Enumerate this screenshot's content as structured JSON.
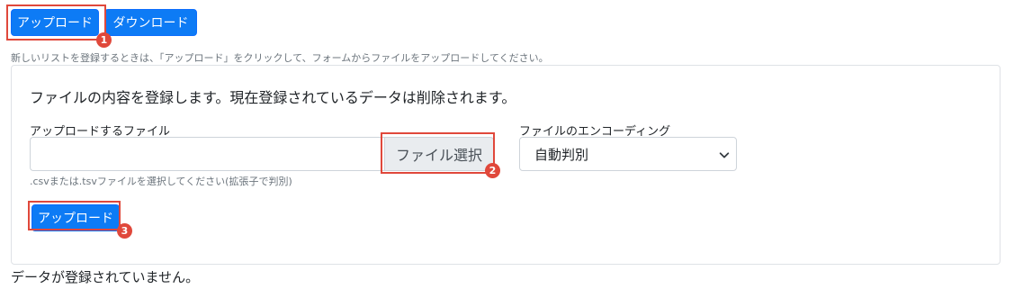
{
  "top_buttons": {
    "upload_label": "アップロード",
    "download_label": "ダウンロード"
  },
  "instructions": "新しいリストを登録するときは、「アップロード」をクリックして、フォームからファイルをアップロードしてください。",
  "panel": {
    "title": "ファイルの内容を登録します。現在登録されているデータは削除されます。",
    "file_label": "アップロードするファイル",
    "file_value": "",
    "file_button_label": "ファイル選択",
    "file_hint": ".csvまたは.tsvファイルを選択してください(拡張子で判別)",
    "encoding_label": "ファイルのエンコーディング",
    "encoding_selected": "自動判別",
    "submit_label": "アップロード"
  },
  "no_data_message": "データが登録されていません。",
  "markers": [
    "1",
    "2",
    "3"
  ],
  "colors": {
    "primary": "#0d7bf5",
    "callout": "#e0483b",
    "border": "#dfe2e6"
  },
  "icons": {
    "select": "chevron-down-icon"
  }
}
